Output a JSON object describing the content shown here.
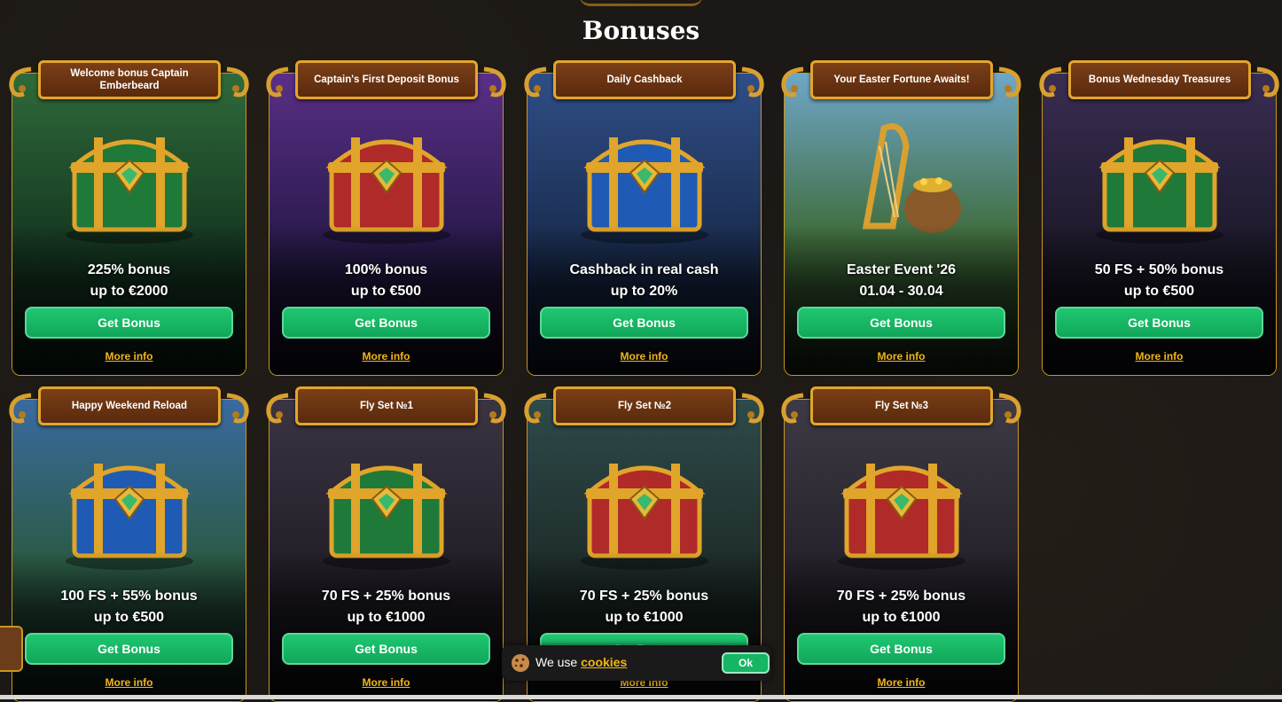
{
  "page": {
    "title": "Bonuses"
  },
  "cards": [
    {
      "badge": "Welcome bonus Captain Emberbeard",
      "line1": "225% bonus",
      "line2": "up to €2000",
      "button": "Get Bonus",
      "more": "More info",
      "theme": "jungle",
      "chest": "green"
    },
    {
      "badge": "Captain's First Deposit Bonus",
      "line1": "100% bonus",
      "line2": "up to €500",
      "button": "Get Bonus",
      "more": "More info",
      "theme": "purple",
      "chest": "red"
    },
    {
      "badge": "Daily Cashback",
      "line1": "Cashback in real cash",
      "line2": "up to 20%",
      "button": "Get Bonus",
      "more": "More info",
      "theme": "blue",
      "chest": "blue"
    },
    {
      "badge": "Your Easter Fortune Awaits!",
      "line1": "Easter Event '26",
      "line2": "01.04 - 30.04",
      "button": "Get Bonus",
      "more": "More info",
      "theme": "spring",
      "chest": "harp"
    },
    {
      "badge": "Bonus Wednesday Treasures",
      "line1": "50 FS + 50% bonus",
      "line2": "up to €500",
      "button": "Get Bonus",
      "more": "More info",
      "theme": "dark",
      "chest": "green"
    },
    {
      "badge": "Happy Weekend Reload",
      "line1": "100 FS + 55% bonus",
      "line2": "up to €500",
      "button": "Get Bonus",
      "more": "More info",
      "theme": "sky",
      "chest": "blue"
    },
    {
      "badge": "Fly Set №1",
      "line1": "70 FS + 25% bonus",
      "line2": "up to €1000",
      "button": "Get Bonus",
      "more": "More info",
      "theme": "cave",
      "chest": "green"
    },
    {
      "badge": "Fly Set №2",
      "line1": "70 FS + 25% bonus",
      "line2": "up to €1000",
      "button": "Get Bonus",
      "more": "More info",
      "theme": "crystal",
      "chest": "red"
    },
    {
      "badge": "Fly Set №3",
      "line1": "70 FS + 25% bonus",
      "line2": "up to €1000",
      "button": "Get Bonus",
      "more": "More info",
      "theme": "crystal2",
      "chest": "red"
    }
  ],
  "cookie": {
    "text": "We use",
    "link": "cookies",
    "ok": "Ok"
  },
  "colors": {
    "accent_green": "#15b563",
    "gold": "#f3b516",
    "banner_brown": "#6b3312"
  }
}
